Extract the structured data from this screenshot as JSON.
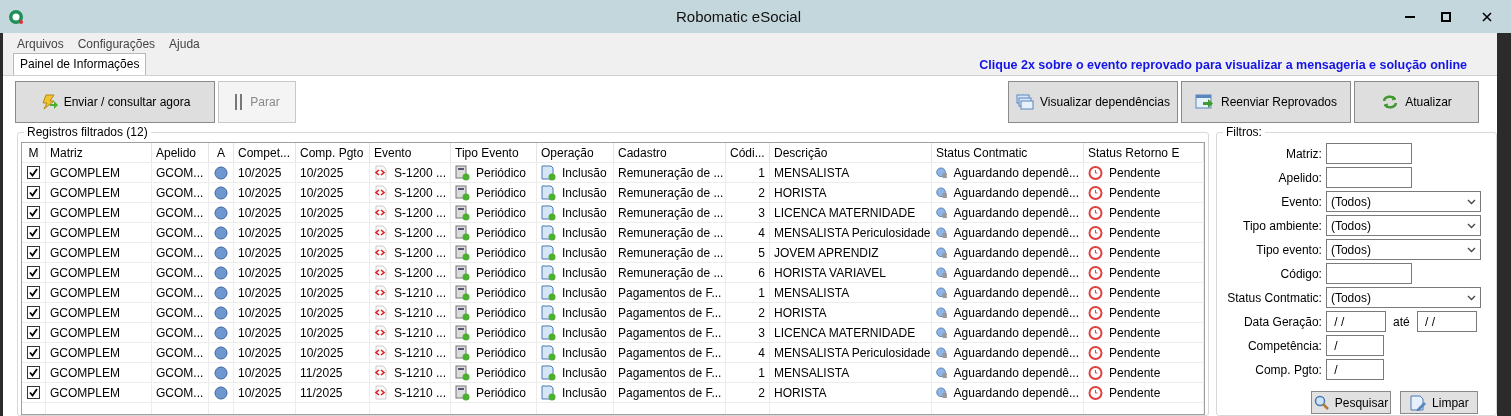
{
  "window": {
    "title": "Robomatic eSocial"
  },
  "menu": [
    "Arquivos",
    "Configurações",
    "Ajuda"
  ],
  "tabs": [
    {
      "label": "Painel de Informações",
      "selected": true
    }
  ],
  "hint": "Clique 2x sobre o evento reprovado para visualizar a mensageria e solução online",
  "left_buttons": [
    {
      "label": "Enviar / consultar agora",
      "kind": "send",
      "disabled": false
    },
    {
      "label": "Parar",
      "kind": "pause",
      "disabled": true
    }
  ],
  "right_buttons": [
    {
      "label": "Visualizar dependências",
      "kind": "windows",
      "disabled": false
    },
    {
      "label": "Reenviar Reprovados",
      "kind": "resend",
      "disabled": false
    },
    {
      "label": "Atualizar",
      "kind": "refresh",
      "disabled": false
    }
  ],
  "records": {
    "title": "Registros filtrados (12)",
    "columns": [
      "M",
      "Matriz",
      "Apelido",
      "A",
      "Compet...",
      "Comp. Pgto",
      "Evento",
      "Tipo Evento",
      "Operação",
      "Cadastro",
      "Códi...",
      "Descrição",
      "Status Contmatic",
      "Status Retorno E"
    ],
    "rows": [
      {
        "checked": true,
        "matriz": "GCOMPLEM",
        "apelido": "GCOM...",
        "competencia": "10/2025",
        "comp_pgto": "10/2025",
        "evento": "S-1200 ...",
        "tipo_evento": "Periódico",
        "operacao": "Inclusão",
        "cadastro": "Remuneração de ...",
        "codigo": "1",
        "descricao": "MENSALISTA",
        "status_contmatic": "Aguardando dependê...",
        "status_retorno": "Pendente"
      },
      {
        "checked": true,
        "matriz": "GCOMPLEM",
        "apelido": "GCOM...",
        "competencia": "10/2025",
        "comp_pgto": "10/2025",
        "evento": "S-1200 ...",
        "tipo_evento": "Periódico",
        "operacao": "Inclusão",
        "cadastro": "Remuneração de ...",
        "codigo": "2",
        "descricao": "HORISTA",
        "status_contmatic": "Aguardando dependê...",
        "status_retorno": "Pendente"
      },
      {
        "checked": true,
        "matriz": "GCOMPLEM",
        "apelido": "GCOM...",
        "competencia": "10/2025",
        "comp_pgto": "10/2025",
        "evento": "S-1200 ...",
        "tipo_evento": "Periódico",
        "operacao": "Inclusão",
        "cadastro": "Remuneração de ...",
        "codigo": "3",
        "descricao": "LICENCA MATERNIDADE",
        "status_contmatic": "Aguardando dependê...",
        "status_retorno": "Pendente"
      },
      {
        "checked": true,
        "matriz": "GCOMPLEM",
        "apelido": "GCOM...",
        "competencia": "10/2025",
        "comp_pgto": "10/2025",
        "evento": "S-1200 ...",
        "tipo_evento": "Periódico",
        "operacao": "Inclusão",
        "cadastro": "Remuneração de ...",
        "codigo": "4",
        "descricao": "MENSALISTA Periculosidade",
        "status_contmatic": "Aguardando dependê...",
        "status_retorno": "Pendente"
      },
      {
        "checked": true,
        "matriz": "GCOMPLEM",
        "apelido": "GCOM...",
        "competencia": "10/2025",
        "comp_pgto": "10/2025",
        "evento": "S-1200 ...",
        "tipo_evento": "Periódico",
        "operacao": "Inclusão",
        "cadastro": "Remuneração de ...",
        "codigo": "5",
        "descricao": "JOVEM APRENDIZ",
        "status_contmatic": "Aguardando dependê...",
        "status_retorno": "Pendente"
      },
      {
        "checked": true,
        "matriz": "GCOMPLEM",
        "apelido": "GCOM...",
        "competencia": "10/2025",
        "comp_pgto": "10/2025",
        "evento": "S-1200 ...",
        "tipo_evento": "Periódico",
        "operacao": "Inclusão",
        "cadastro": "Remuneração de ...",
        "codigo": "6",
        "descricao": "HORISTA  VARIAVEL",
        "status_contmatic": "Aguardando dependê...",
        "status_retorno": "Pendente"
      },
      {
        "checked": true,
        "matriz": "GCOMPLEM",
        "apelido": "GCOM...",
        "competencia": "10/2025",
        "comp_pgto": "10/2025",
        "evento": "S-1210 ...",
        "tipo_evento": "Periódico",
        "operacao": "Inclusão",
        "cadastro": "Pagamentos de F...",
        "codigo": "1",
        "descricao": "MENSALISTA",
        "status_contmatic": "Aguardando dependê...",
        "status_retorno": "Pendente"
      },
      {
        "checked": true,
        "matriz": "GCOMPLEM",
        "apelido": "GCOM...",
        "competencia": "10/2025",
        "comp_pgto": "10/2025",
        "evento": "S-1210 ...",
        "tipo_evento": "Periódico",
        "operacao": "Inclusão",
        "cadastro": "Pagamentos de F...",
        "codigo": "2",
        "descricao": "HORISTA",
        "status_contmatic": "Aguardando dependê...",
        "status_retorno": "Pendente"
      },
      {
        "checked": true,
        "matriz": "GCOMPLEM",
        "apelido": "GCOM...",
        "competencia": "10/2025",
        "comp_pgto": "10/2025",
        "evento": "S-1210 ...",
        "tipo_evento": "Periódico",
        "operacao": "Inclusão",
        "cadastro": "Pagamentos de F...",
        "codigo": "3",
        "descricao": "LICENCA MATERNIDADE",
        "status_contmatic": "Aguardando dependê...",
        "status_retorno": "Pendente"
      },
      {
        "checked": true,
        "matriz": "GCOMPLEM",
        "apelido": "GCOM...",
        "competencia": "10/2025",
        "comp_pgto": "10/2025",
        "evento": "S-1210 ...",
        "tipo_evento": "Periódico",
        "operacao": "Inclusão",
        "cadastro": "Pagamentos de F...",
        "codigo": "4",
        "descricao": "MENSALISTA Periculosidade",
        "status_contmatic": "Aguardando dependê...",
        "status_retorno": "Pendente"
      },
      {
        "checked": true,
        "matriz": "GCOMPLEM",
        "apelido": "GCOM...",
        "competencia": "10/2025",
        "comp_pgto": "11/2025",
        "evento": "S-1210 ...",
        "tipo_evento": "Periódico",
        "operacao": "Inclusão",
        "cadastro": "Pagamentos de F...",
        "codigo": "1",
        "descricao": "MENSALISTA",
        "status_contmatic": "Aguardando dependê...",
        "status_retorno": "Pendente"
      },
      {
        "checked": true,
        "matriz": "GCOMPLEM",
        "apelido": "GCOM...",
        "competencia": "10/2025",
        "comp_pgto": "11/2025",
        "evento": "S-1210 ...",
        "tipo_evento": "Periódico",
        "operacao": "Inclusão",
        "cadastro": "Pagamentos de F...",
        "codigo": "2",
        "descricao": "HORISTA",
        "status_contmatic": "Aguardando dependê...",
        "status_retorno": "Pendente"
      }
    ]
  },
  "filters": {
    "title": "Filtros:",
    "fields": [
      {
        "label": "Matriz:",
        "kind": "text"
      },
      {
        "label": "Apelido:",
        "kind": "text"
      },
      {
        "label": "Evento:",
        "kind": "select",
        "value": "(Todos)"
      },
      {
        "label": "Tipo ambiente:",
        "kind": "select",
        "value": "(Todos)"
      },
      {
        "label": "Tipo evento:",
        "kind": "select",
        "value": "(Todos)"
      },
      {
        "label": "Código:",
        "kind": "text"
      },
      {
        "label": "Status Contmatic:",
        "kind": "select",
        "value": "(Todos)"
      },
      {
        "label": "Data Geração:",
        "kind": "range",
        "value": " / /",
        "between": "até",
        "value_to": " / /"
      },
      {
        "label": "Competência:",
        "kind": "short",
        "value": " /"
      },
      {
        "label": "Comp. Pgto:",
        "kind": "short",
        "value": " /"
      }
    ],
    "buttons": [
      {
        "label": "Pesquisar",
        "kind": "search"
      },
      {
        "label": "Limpar",
        "kind": "clear"
      }
    ]
  }
}
